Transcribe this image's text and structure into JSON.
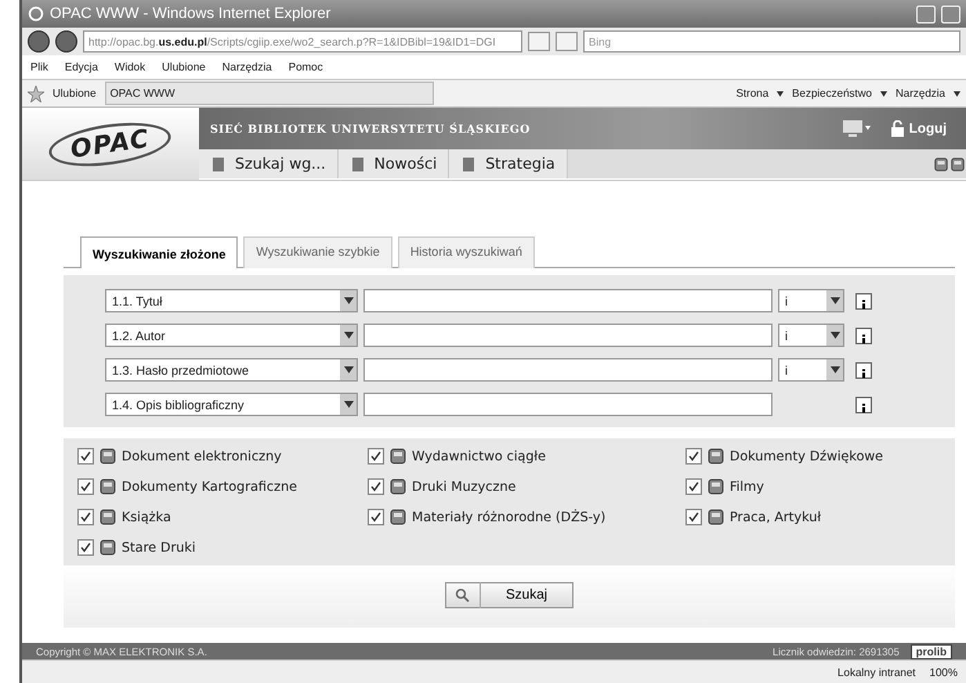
{
  "window": {
    "title": "OPAC WWW - Windows Internet Explorer"
  },
  "address_bar": {
    "url": "http://opac.bg.**us.edu.pl**/Scripts/cgiip.exe/wo2_search.p?R=1&IDBibl=19&ID1=DGI",
    "search_placeholder": "Bing"
  },
  "menu": [
    "Plik",
    "Edycja",
    "Widok",
    "Ulubione",
    "Narzędzia",
    "Pomoc"
  ],
  "favorites_bar": {
    "favorites": "Ulubione",
    "tab": "OPAC WWW",
    "commands": [
      "Strona",
      "Bezpieczeństwo",
      "Narzędzia"
    ]
  },
  "header": {
    "logo": "OPAC",
    "title": "SIEĆ BIBLIOTEK UNIWERSYTETU ŚLĄSKIEGO",
    "login": "Loguj"
  },
  "nav": [
    "Szukaj wg...",
    "Nowości",
    "Strategia"
  ],
  "tabs": [
    {
      "label": "Wyszukiwanie złożone",
      "selected": true
    },
    {
      "label": "Wyszukiwanie szybkie",
      "selected": false
    },
    {
      "label": "Historia wyszukiwań",
      "selected": false
    }
  ],
  "rows": [
    {
      "field": "1.1. Tytuł",
      "operator": "i"
    },
    {
      "field": "1.2. Autor",
      "operator": "i"
    },
    {
      "field": "1.3. Hasło przedmiotowe",
      "operator": "i"
    },
    {
      "field": "1.4. Opis bibliograficzny"
    }
  ],
  "doc_types": [
    {
      "label": "Dokument elektroniczny",
      "checked": true
    },
    {
      "label": "Wydawnictwo ciągłe",
      "checked": true
    },
    {
      "label": "Dokumenty Dźwiękowe",
      "checked": true
    },
    {
      "label": "Dokumenty Kartograficzne",
      "checked": true
    },
    {
      "label": "Druki Muzyczne",
      "checked": true
    },
    {
      "label": "Filmy",
      "checked": true
    },
    {
      "label": "Książka",
      "checked": true
    },
    {
      "label": "Materiały różnorodne (DŻS-y)",
      "checked": true
    },
    {
      "label": "Praca, Artykuł",
      "checked": true
    },
    {
      "label": "Stare Druki",
      "checked": true
    }
  ],
  "search_button": "Szukaj",
  "footer": {
    "copyright": "Copyright © MAX ELEKTRONIK S.A.",
    "counter": "Licznik odwiedzin: 2691305",
    "badge": "prolib"
  },
  "status_bar": {
    "zone": "Lokalny intranet",
    "zoom": "100%"
  }
}
